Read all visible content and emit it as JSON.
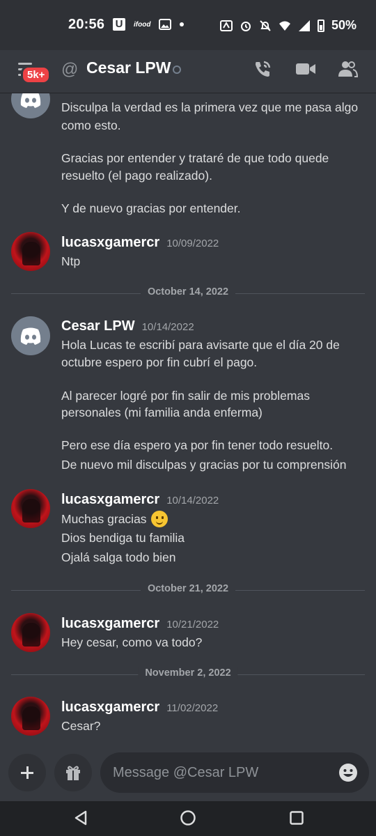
{
  "status_bar": {
    "time": "20:56",
    "ifood": "ifood",
    "u_icon": "U",
    "battery": "50%",
    "icons": [
      "auto-icon",
      "alarm-icon",
      "mute-bell-icon",
      "wifi-icon",
      "signal-icon",
      "battery-icon"
    ]
  },
  "header": {
    "badge": "5k+",
    "at": "@",
    "title": "Cesar LPW",
    "icons": [
      "hamburger-icon",
      "call-icon",
      "video-icon",
      "members-icon"
    ]
  },
  "chat": {
    "messages": [
      {
        "author": "",
        "time": "",
        "lines": [
          "Disculpa la verdad es la primera vez que me pasa algo",
          "como esto.",
          "Gracias por entender y trataré de que todo quede",
          "resuelto (el pago realizado).",
          "Y de nuevo gracias por entender."
        ]
      },
      {
        "author": "lucasxgamercr",
        "time": "10/09/2022",
        "lines": [
          "Ntp"
        ]
      },
      {
        "author": "Cesar LPW",
        "time": "10/14/2022",
        "lines": [
          "Hola Lucas te escribí para avisarte que el día 20 de",
          "octubre espero por fin cubrí el pago.",
          "Al parecer logré por fin salir de mis problemas",
          "personales (mi familia anda enferma)",
          "Pero ese día espero ya por fin tener todo resuelto.",
          "De nuevo mil disculpas y gracias por tu comprensión"
        ]
      },
      {
        "author": "lucasxgamercr",
        "time": "10/14/2022",
        "lines": [
          "Muchas gracias",
          "Dios bendiga tu familia",
          "Ojalá salga todo bien"
        ]
      },
      {
        "author": "lucasxgamercr",
        "time": "10/21/2022",
        "lines": [
          "Hey cesar, como va todo?"
        ]
      },
      {
        "author": "lucasxgamercr",
        "time": "11/02/2022",
        "lines": [
          "Cesar?"
        ]
      }
    ],
    "dividers": [
      "October 14, 2022",
      "October 21, 2022",
      "November 2, 2022"
    ]
  },
  "composer": {
    "placeholder": "Message @Cesar LPW",
    "icons": [
      "plus-icon",
      "gift-icon",
      "emoji-icon"
    ]
  },
  "colors": {
    "background": "#36393f",
    "bars": "#2f3136",
    "badge": "#ed4245",
    "avatar_red": "#c0141b"
  }
}
